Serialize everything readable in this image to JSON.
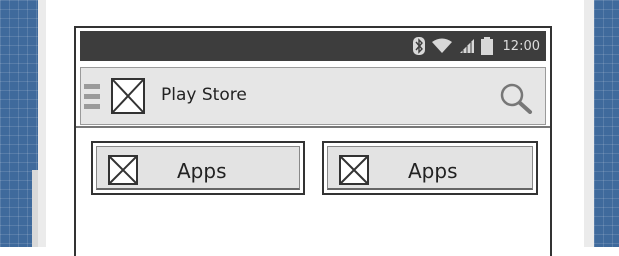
{
  "status_bar": {
    "time": "12:00",
    "icons": [
      "bluetooth-icon",
      "wifi-icon",
      "signal-icon",
      "battery-icon"
    ]
  },
  "app_bar": {
    "title": "Play Store",
    "icons": [
      "menu-icon",
      "logo-placeholder",
      "search-icon"
    ]
  },
  "tiles": [
    {
      "label": "Apps",
      "icon": "image-placeholder-icon"
    },
    {
      "label": "Apps",
      "icon": "image-placeholder-icon"
    }
  ],
  "colors": {
    "status_bar_bg": "#3d3d3d",
    "app_bar_bg": "#e6e6e6",
    "blueprint": "#3f6a9c"
  }
}
